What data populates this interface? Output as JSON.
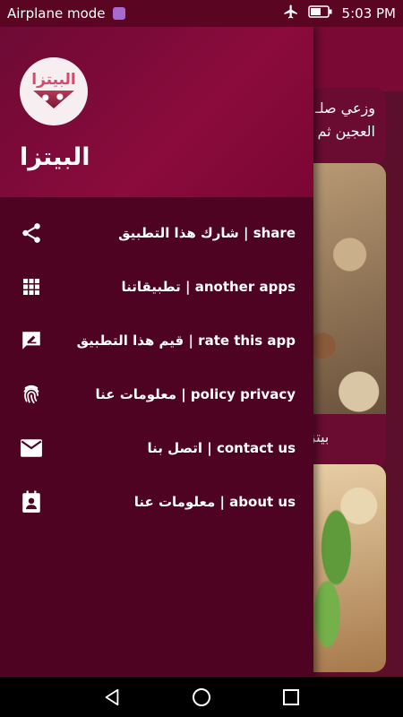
{
  "status_bar": {
    "left_text": "Airplane mode",
    "time": "5:03 PM",
    "icons": [
      "notification-icon",
      "airplane-icon",
      "battery-icon"
    ]
  },
  "drawer": {
    "logo_text": "البيتزا",
    "app_name": "البيتزا",
    "items": [
      {
        "icon": "share-icon",
        "label": "شارك هذا التطبيق | share"
      },
      {
        "icon": "apps-grid-icon",
        "label": "تطبيقاتنا | another apps"
      },
      {
        "icon": "rate-icon",
        "label": "قيم هذا التطبيق | rate this app"
      },
      {
        "icon": "fingerprint-icon",
        "label": "معلومات عنا | policy privacy"
      },
      {
        "icon": "mail-icon",
        "label": "اتصل بنا | contact us"
      },
      {
        "icon": "contact-card-icon",
        "label": "معلومات عنا | about us"
      }
    ]
  },
  "background": {
    "card1_text": "وزعي صلـ العجين ثم",
    "card2_caption": "بيتزا"
  },
  "nav_bar": {
    "buttons": [
      "back-icon",
      "home-icon",
      "recents-icon"
    ]
  },
  "colors": {
    "drawer_bg": "#4f0323",
    "header_bg": "#8a0b3c",
    "status_bar": "#5a0622",
    "text": "#ffffff"
  }
}
